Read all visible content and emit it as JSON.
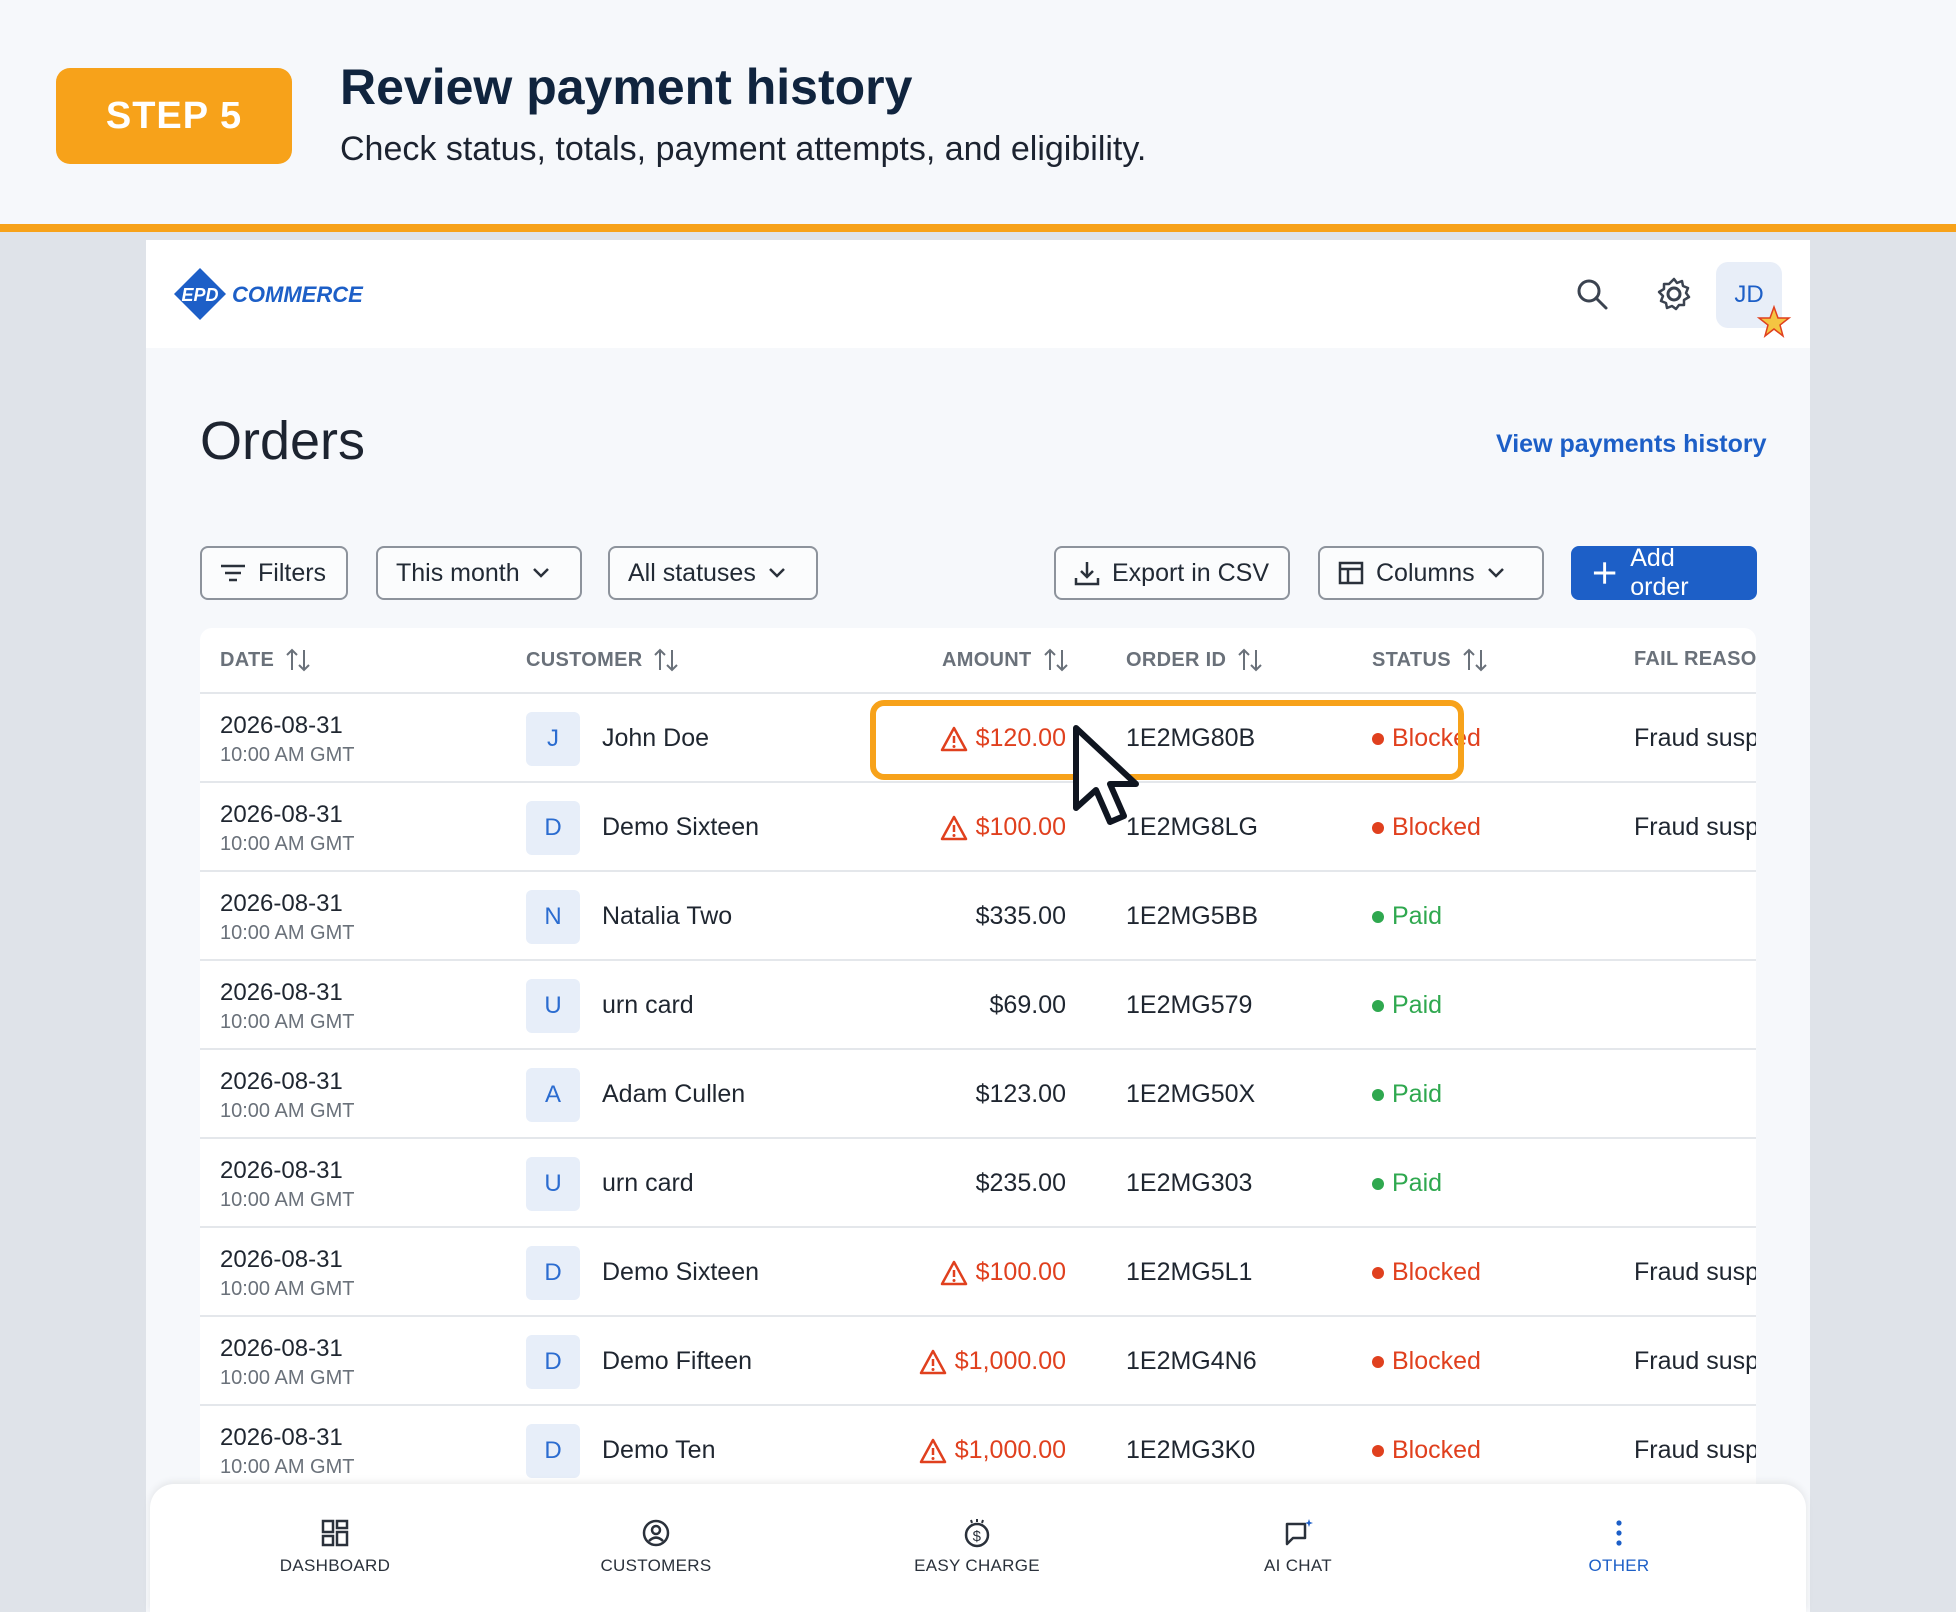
{
  "banner": {
    "step": "STEP 5",
    "title": "Review payment history",
    "subtitle": "Check status, totals, payment attempts, and eligibility."
  },
  "header": {
    "avatar_initials": "JD"
  },
  "page": {
    "title": "Orders",
    "history_link": "View payments history"
  },
  "toolbar": {
    "filters": "Filters",
    "period": "This month",
    "status": "All statuses",
    "export": "Export in CSV",
    "columns": "Columns",
    "add": "Add order"
  },
  "table": {
    "headers": [
      "DATE",
      "CUSTOMER",
      "AMOUNT",
      "ORDER ID",
      "STATUS",
      "FAIL REASON"
    ],
    "rows": [
      {
        "date": "2026-08-31",
        "time": "10:00 AM GMT",
        "initial": "J",
        "customer": "John Doe",
        "amount": "$120.00",
        "warn": true,
        "order_id": "1E2MG80B",
        "status": "Blocked",
        "fail": "Fraud suspected"
      },
      {
        "date": "2026-08-31",
        "time": "10:00 AM GMT",
        "initial": "D",
        "customer": "Demo Sixteen",
        "amount": "$100.00",
        "warn": true,
        "order_id": "1E2MG8LG",
        "status": "Blocked",
        "fail": "Fraud suspected"
      },
      {
        "date": "2026-08-31",
        "time": "10:00 AM GMT",
        "initial": "N",
        "customer": "Natalia Two",
        "amount": "$335.00",
        "warn": false,
        "order_id": "1E2MG5BB",
        "status": "Paid",
        "fail": ""
      },
      {
        "date": "2026-08-31",
        "time": "10:00 AM GMT",
        "initial": "U",
        "customer": "urn card",
        "amount": "$69.00",
        "warn": false,
        "order_id": "1E2MG579",
        "status": "Paid",
        "fail": ""
      },
      {
        "date": "2026-08-31",
        "time": "10:00 AM GMT",
        "initial": "A",
        "customer": "Adam Cullen",
        "amount": "$123.00",
        "warn": false,
        "order_id": "1E2MG50X",
        "status": "Paid",
        "fail": ""
      },
      {
        "date": "2026-08-31",
        "time": "10:00 AM GMT",
        "initial": "U",
        "customer": "urn card",
        "amount": "$235.00",
        "warn": false,
        "order_id": "1E2MG303",
        "status": "Paid",
        "fail": ""
      },
      {
        "date": "2026-08-31",
        "time": "10:00 AM GMT",
        "initial": "D",
        "customer": "Demo Sixteen",
        "amount": "$100.00",
        "warn": true,
        "order_id": "1E2MG5L1",
        "status": "Blocked",
        "fail": "Fraud suspected"
      },
      {
        "date": "2026-08-31",
        "time": "10:00 AM GMT",
        "initial": "D",
        "customer": "Demo Fifteen",
        "amount": "$1,000.00",
        "warn": true,
        "order_id": "1E2MG4N6",
        "status": "Blocked",
        "fail": "Fraud suspected"
      },
      {
        "date": "2026-08-31",
        "time": "10:00 AM GMT",
        "initial": "D",
        "customer": "Demo Ten",
        "amount": "$1,000.00",
        "warn": true,
        "order_id": "1E2MG3K0",
        "status": "Blocked",
        "fail": "Fraud suspected"
      }
    ]
  },
  "nav": {
    "items": [
      "DASHBOARD",
      "CUSTOMERS",
      "EASY CHARGE",
      "AI CHAT",
      "OTHER"
    ],
    "active": "OTHER"
  },
  "colors": {
    "accent": "#f7a21a",
    "primary": "#1d5fc7",
    "blocked": "#e0401e",
    "paid": "#2fa84f"
  },
  "logo_text": "EPD COMMERCE"
}
